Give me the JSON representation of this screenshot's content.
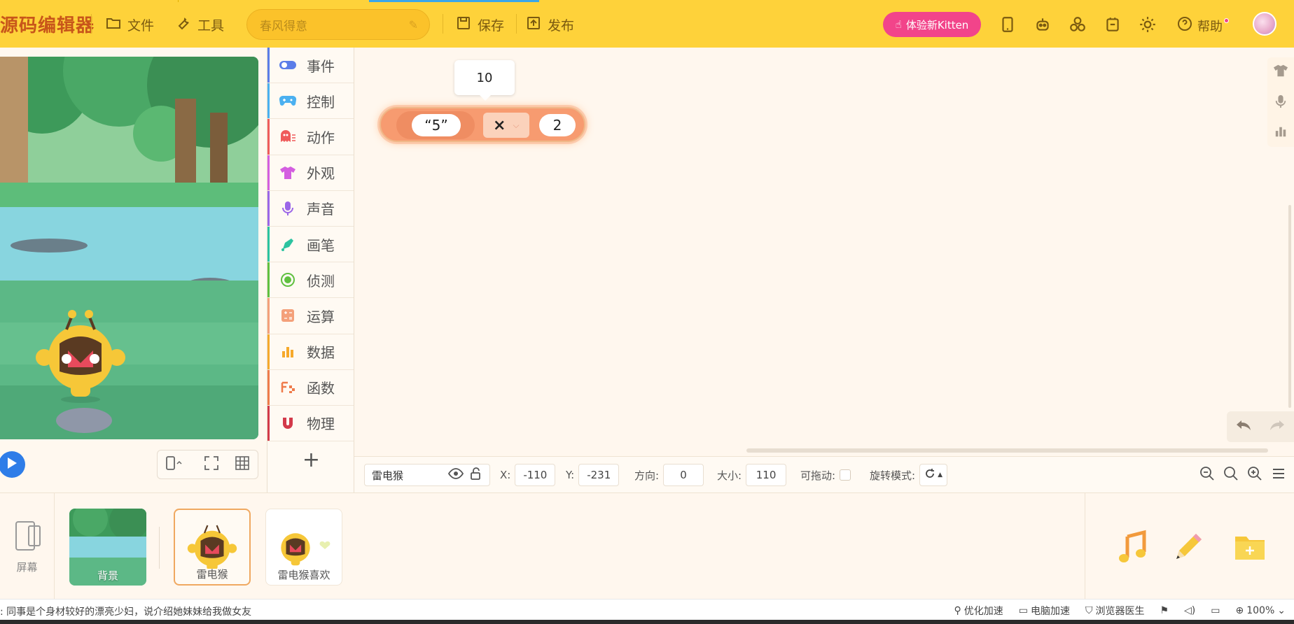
{
  "topbar": {
    "logo": "源码编辑器",
    "file_label": "文件",
    "tools_label": "工具",
    "project_name_placeholder": "春风得意",
    "save_label": "保存",
    "publish_label": "发布",
    "kitten_label": "体验新Kitten",
    "help_label": "帮助"
  },
  "categories": [
    {
      "label": "事件",
      "color": "#5b7de8"
    },
    {
      "label": "控制",
      "color": "#4bb0f0"
    },
    {
      "label": "动作",
      "color": "#ef5b5b"
    },
    {
      "label": "外观",
      "color": "#d45ee0"
    },
    {
      "label": "声音",
      "color": "#9b66e8"
    },
    {
      "label": "画笔",
      "color": "#2cc3a0"
    },
    {
      "label": "侦测",
      "color": "#60c040"
    },
    {
      "label": "运算",
      "color": "#f4a07a"
    },
    {
      "label": "数据",
      "color": "#f6a92b"
    },
    {
      "label": "函数",
      "color": "#ef7b4b"
    },
    {
      "label": "物理",
      "color": "#d33a4a"
    }
  ],
  "workspace": {
    "tooltip_value": "10",
    "block_string": "“5”",
    "block_operator": "×",
    "block_number": "2"
  },
  "properties": {
    "sprite_name": "雷电猴",
    "x_label": "X:",
    "x_value": "-110",
    "y_label": "Y:",
    "y_value": "-231",
    "direction_label": "方向:",
    "direction_value": "0",
    "size_label": "大小:",
    "size_value": "110",
    "draggable_label": "可拖动:",
    "rotation_label": "旋转模式:"
  },
  "sprites": {
    "screen_label": "屏幕",
    "items": [
      {
        "label": "背景"
      },
      {
        "label": "雷电猴"
      },
      {
        "label": "雷电猴喜欢"
      }
    ]
  },
  "statusbar": {
    "left_text": ": 同事是个身材较好的漂亮少妇，说介绍她妹妹给我做女友",
    "optimize": "优化加速",
    "pc_speed": "电脑加速",
    "browser_doctor": "浏览器医生",
    "zoom": "100%"
  },
  "colors": {
    "topbar": "#fed23a",
    "kitten": "#f2448a",
    "block": "#f79b70",
    "play": "#2e7de8"
  }
}
